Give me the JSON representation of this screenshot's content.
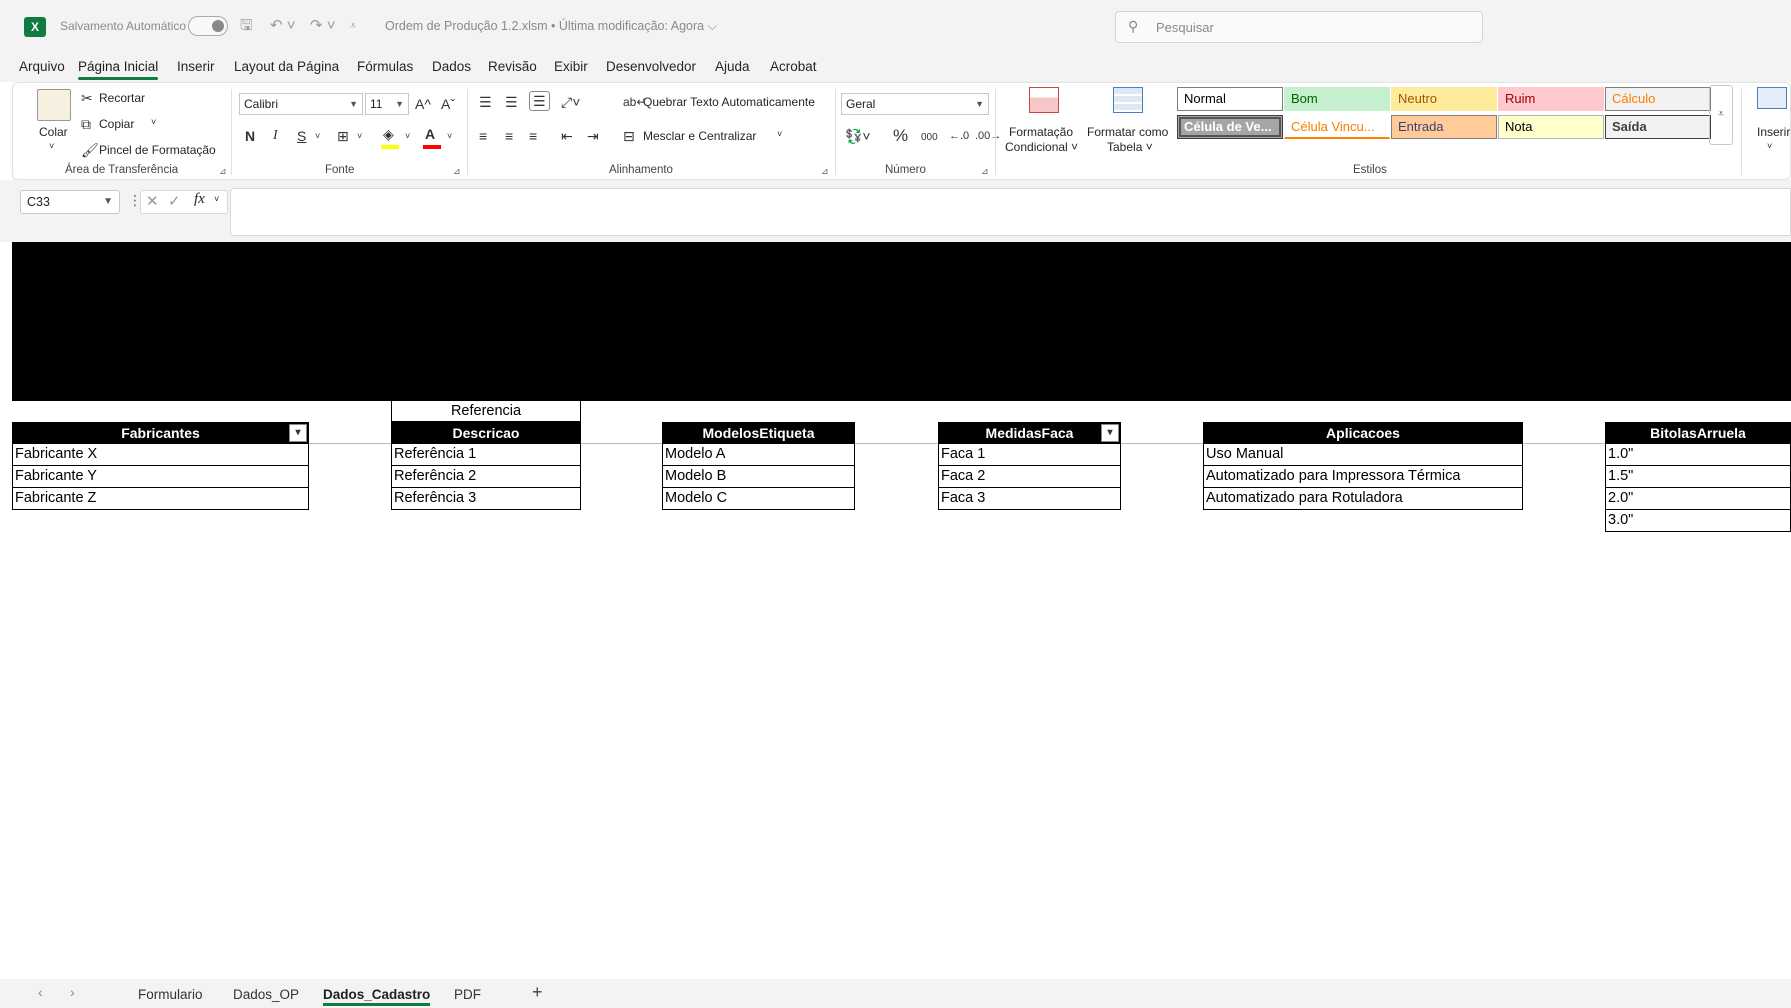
{
  "titlebar": {
    "app_logo": "X",
    "autosave_label": "Salvamento Automático",
    "doc_title": "Ordem de Produção 1.2.xlsm  •  Última modificação: Agora ⌵",
    "search_placeholder": "Pesquisar"
  },
  "menu": {
    "tabs": [
      "Arquivo",
      "Página Inicial",
      "Inserir",
      "Layout da Página",
      "Fórmulas",
      "Dados",
      "Revisão",
      "Exibir",
      "Desenvolvedor",
      "Ajuda",
      "Acrobat"
    ],
    "active": "Página Inicial"
  },
  "ribbon": {
    "clipboard": {
      "paste_label": "Colar",
      "cut_label": "Recortar",
      "copy_label": "Copiar",
      "format_painter_label": "Pincel de Formatação",
      "group_label": "Área de Transferência"
    },
    "font": {
      "font_name": "Calibri",
      "font_size": "11",
      "bold_label": "N",
      "italic_label": "I",
      "underline_label": "S",
      "group_label": "Fonte",
      "fill_color": "#ffff00",
      "font_color": "#ff0000"
    },
    "alignment": {
      "wrap_text_label": "Quebrar Texto Automaticamente",
      "merge_center_label": "Mesclar e Centralizar",
      "group_label": "Alinhamento"
    },
    "number": {
      "format": "Geral",
      "percent_label": "%",
      "thousands_label": "000",
      "group_label": "Número"
    },
    "styles": {
      "conditional_label_1": "Formatação",
      "conditional_label_2": "Condicional ˅",
      "format_table_label_1": "Formatar como",
      "format_table_label_2": "Tabela ˅",
      "cells": [
        {
          "label": "Normal",
          "bg": "#ffffff",
          "fg": "#000000",
          "border": "#7f7f7f"
        },
        {
          "label": "Bom",
          "bg": "#c6efce",
          "fg": "#006100",
          "border": "#c6efce"
        },
        {
          "label": "Neutro",
          "bg": "#ffeb9c",
          "fg": "#9c5700",
          "border": "#ffeb9c"
        },
        {
          "label": "Ruim",
          "bg": "#ffc7ce",
          "fg": "#9c0006",
          "border": "#ffc7ce"
        },
        {
          "label": "Cálculo",
          "bg": "#f2f2f2",
          "fg": "#fa7d00",
          "border": "#7f7f7f"
        },
        {
          "label": "Célula de Ve...",
          "bg": "#a5a5a5",
          "fg": "#ffffff",
          "border": "#3f3f3f"
        },
        {
          "label": "Célula Vincu...",
          "bg": "#ffffff",
          "fg": "#fa7d00",
          "border": "#ffffff"
        },
        {
          "label": "Entrada",
          "bg": "#ffcc99",
          "fg": "#3f3f76",
          "border": "#7f7f7f"
        },
        {
          "label": "Nota",
          "bg": "#ffffcc",
          "fg": "#000000",
          "border": "#b2b2b2"
        },
        {
          "label": "Saída",
          "bg": "#f2f2f2",
          "fg": "#3f3f3f",
          "border": "#3f3f3f"
        }
      ],
      "group_label": "Estilos"
    },
    "cells": {
      "insert_label": "Inserir"
    }
  },
  "formula_bar": {
    "name_box": "C33",
    "fx_label": "fx",
    "formula": ""
  },
  "sheet": {
    "above_header": "Referencia",
    "tables": [
      {
        "header": "Fabricantes",
        "filter": true,
        "rows": [
          "Fabricante X",
          "Fabricante Y",
          "Fabricante Z"
        ]
      },
      {
        "header": "Descricao",
        "filter": false,
        "rows": [
          "Referência 1",
          "Referência 2",
          "Referência 3"
        ]
      },
      {
        "header": "ModelosEtiqueta",
        "filter": false,
        "rows": [
          "Modelo A",
          "Modelo B",
          "Modelo C"
        ]
      },
      {
        "header": "MedidasFaca",
        "filter": true,
        "rows": [
          "Faca 1",
          "Faca 2",
          "Faca 3"
        ]
      },
      {
        "header": "Aplicacoes",
        "filter": false,
        "rows": [
          "Uso Manual",
          "Automatizado para Impressora Térmica",
          "Automatizado para Rotuladora"
        ]
      },
      {
        "header": "BitolasArruela",
        "filter": false,
        "rows": [
          "1.0\"",
          "1.5\"",
          "2.0\"",
          "3.0\""
        ]
      }
    ]
  },
  "sheet_tabs": {
    "tabs": [
      "Formulario",
      "Dados_OP",
      "Dados_Cadastro",
      "PDF"
    ],
    "active": "Dados_Cadastro",
    "add_label": "+"
  },
  "colors": {
    "accent": "#107c41"
  }
}
